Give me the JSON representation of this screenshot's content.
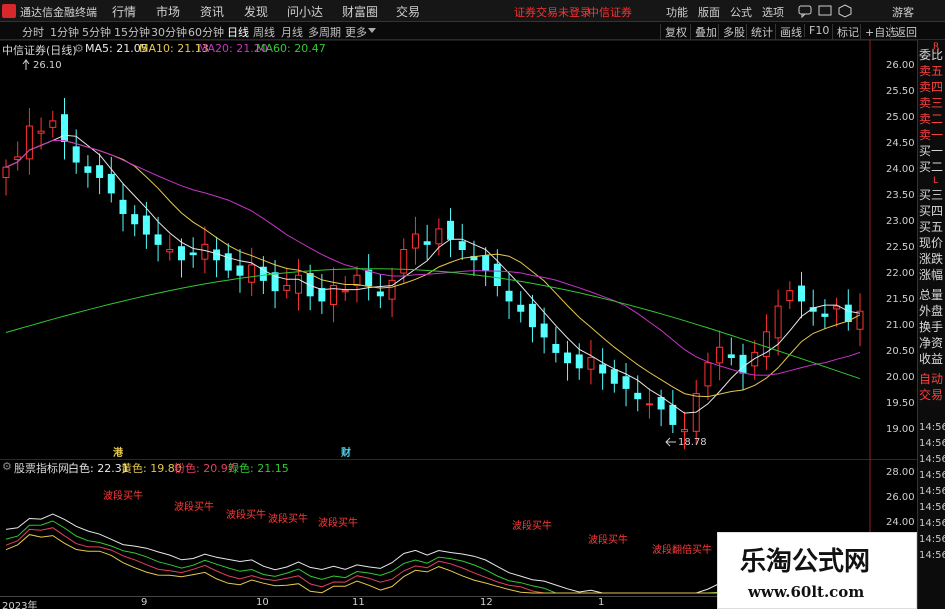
{
  "menubar": {
    "app_title": "通达信金融终端",
    "items": [
      "行情",
      "市场",
      "资讯",
      "发现",
      "问小达",
      "财富圈",
      "交易"
    ],
    "broker_warning": "证券交易未登录",
    "broker_name": "中信证券",
    "right_items": [
      "功能",
      "版面",
      "公式",
      "选项"
    ],
    "guest": "游客",
    "window_buttons": [
      "—",
      "□",
      "✕"
    ]
  },
  "period_tabs": {
    "items": [
      "分时",
      "1分钟",
      "5分钟",
      "15分钟",
      "30分钟",
      "60分钟",
      "日线",
      "周线",
      "月线",
      "多周期",
      "更多"
    ],
    "active": "日线",
    "tools": [
      "复权",
      "叠加",
      "多股",
      "统计",
      "画线",
      "F10",
      "标记",
      "+自选",
      "返回"
    ]
  },
  "main_chart": {
    "stock_title": "中信证券(日线)",
    "ma": [
      {
        "label": "MA5: 21.05",
        "color": "#e8e8e8"
      },
      {
        "label": "MA10: 21.13",
        "color": "#e6c84a"
      },
      {
        "label": "MA20: 21.20",
        "color": "#c832c8"
      },
      {
        "label": "MA60: 20.47",
        "color": "#32c832"
      }
    ],
    "high_marker": "26.10",
    "low_marker": "18.78",
    "event_markers": [
      {
        "text": "港",
        "color": "#e6c84a"
      },
      {
        "text": "财",
        "color": "#4ad2e6"
      }
    ],
    "price_axis": [
      "26.00",
      "25.50",
      "25.00",
      "24.50",
      "24.00",
      "23.50",
      "23.00",
      "22.50",
      "22.00",
      "21.50",
      "21.00",
      "20.50",
      "20.00",
      "19.50",
      "19.00"
    ]
  },
  "sub_chart": {
    "title": "股票指标网",
    "lines": [
      {
        "label": "白色: 22.31",
        "color": "#e8e8e8"
      },
      {
        "label": "黄色: 19.80",
        "color": "#e6c84a"
      },
      {
        "label": "粉色: 20.97",
        "color": "#e04060"
      },
      {
        "label": "绿色: 21.15",
        "color": "#32c832"
      }
    ],
    "axis": [
      "28.00",
      "26.00",
      "24.00"
    ],
    "signals": [
      "波段买牛",
      "波段买牛",
      "波段买牛",
      "波段买牛",
      "波段买牛",
      "波段买牛",
      "波段买牛",
      "波段翻倍买牛"
    ]
  },
  "date_axis": [
    "2023年",
    "9",
    "10",
    "11",
    "12",
    "1"
  ],
  "side_panel": {
    "items": [
      "委比",
      "卖五",
      "卖四",
      "卖三",
      "卖二",
      "卖一",
      "买一",
      "买二",
      "买三",
      "买四",
      "买五",
      "现价",
      "涨跌",
      "涨幅",
      "总量",
      "外盘",
      "换手",
      "净资",
      "收益",
      "自动",
      "交易"
    ],
    "corner": [
      "R",
      "L"
    ],
    "times": [
      "14:56",
      "14:56",
      "14:56",
      "14:56",
      "14:56",
      "14:56",
      "14:56",
      "14:56",
      "14:56"
    ]
  },
  "watermark": {
    "title": "乐淘公式网",
    "url": "www.60lt.com"
  },
  "colors": {
    "up": "#ff3232",
    "down": "#54ffff",
    "ma5": "#e8e8e8",
    "ma10": "#e6c84a",
    "ma20": "#c832c8",
    "ma60": "#32c832"
  },
  "chart_data": {
    "type": "candlestick",
    "title": "中信证券(日线)",
    "ylim": [
      18.7,
      26.3
    ],
    "closes": [
      24.1,
      24.3,
      24.9,
      24.8,
      25.0,
      24.6,
      24.2,
      24.0,
      23.9,
      23.6,
      23.2,
      23.0,
      22.8,
      22.6,
      22.5,
      22.3,
      22.4,
      22.6,
      22.3,
      22.1,
      22.0,
      22.2,
      21.9,
      21.7,
      21.8,
      22.0,
      21.6,
      21.5,
      21.8,
      21.7,
      22.0,
      21.8,
      21.6,
      21.9,
      22.5,
      22.8,
      22.6,
      22.9,
      22.7,
      22.5,
      22.3,
      22.1,
      21.8,
      21.5,
      21.3,
      21.0,
      20.8,
      20.5,
      20.3,
      20.2,
      20.4,
      20.1,
      19.9,
      19.8,
      19.6,
      19.5,
      19.4,
      19.1,
      19.0,
      19.7,
      20.3,
      20.6,
      20.4,
      20.1,
      20.5,
      20.9,
      21.4,
      21.7,
      21.5,
      21.3,
      21.2,
      21.4,
      21.1,
      21.3
    ]
  }
}
